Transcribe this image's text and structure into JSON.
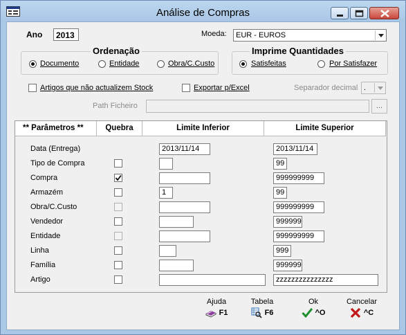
{
  "window": {
    "title": "Análise de Compras"
  },
  "header": {
    "ano_label": "Ano",
    "ano_value": "2013",
    "moeda_label": "Moeda:",
    "moeda_value": "EUR - EUROS"
  },
  "ordenacao": {
    "title": "Ordenação",
    "options": [
      "Documento",
      "Entidade",
      "Obra/C.Custo"
    ],
    "selected": "Documento"
  },
  "imprime": {
    "title": "Imprime Quantidades",
    "options": [
      "Satisfeitas",
      "Por Satisfazer"
    ],
    "selected": "Satisfeitas"
  },
  "options": {
    "artigos_label": "Artigos que não actualizem Stock",
    "exportar_label": "Exportar p/Excel",
    "separador_label": "Separador decimal",
    "separador_value": ".",
    "path_label": "Path Ficheiro",
    "path_value": "",
    "browse_label": "..."
  },
  "grid": {
    "headers": {
      "parametros": "**  Parâmetros  **",
      "quebra": "Quebra",
      "inferior": "Limite Inferior",
      "superior": "Limite Superior"
    },
    "rows": [
      {
        "name": "Data (Entrega)",
        "quebra": null,
        "inferior": "2013/11/14",
        "superior": "2013/11/14"
      },
      {
        "name": "Tipo de Compra",
        "quebra": false,
        "inferior": "",
        "superior": "99"
      },
      {
        "name": "Compra",
        "quebra": true,
        "inferior": "",
        "superior": "999999999"
      },
      {
        "name": "Armazém",
        "quebra": false,
        "inferior": "1",
        "superior": "99"
      },
      {
        "name": "Obra/C.Custo",
        "quebra": false,
        "inferior": "",
        "superior": "999999999"
      },
      {
        "name": "Vendedor",
        "quebra": false,
        "inferior": "",
        "superior": "999999"
      },
      {
        "name": "Entidade",
        "quebra": false,
        "inferior": "",
        "superior": "999999999"
      },
      {
        "name": "Linha",
        "quebra": false,
        "inferior": "",
        "superior": "999"
      },
      {
        "name": "Família",
        "quebra": false,
        "inferior": "",
        "superior": "999999"
      },
      {
        "name": "Artigo",
        "quebra": false,
        "inferior": "",
        "superior": "zzzzzzzzzzzzzzz"
      }
    ]
  },
  "actions": [
    {
      "label": "Ajuda",
      "key": "F1",
      "icon": "book-icon",
      "color": "#8a3f9e"
    },
    {
      "label": "Tabela",
      "key": "F6",
      "icon": "table-search-icon",
      "color": "#2f6fb7"
    },
    {
      "label": "Ok",
      "key": "^O",
      "icon": "check-icon",
      "color": "#1e8f2a"
    },
    {
      "label": "Cancelar",
      "key": "^C",
      "icon": "x-icon",
      "color": "#c01818"
    }
  ]
}
